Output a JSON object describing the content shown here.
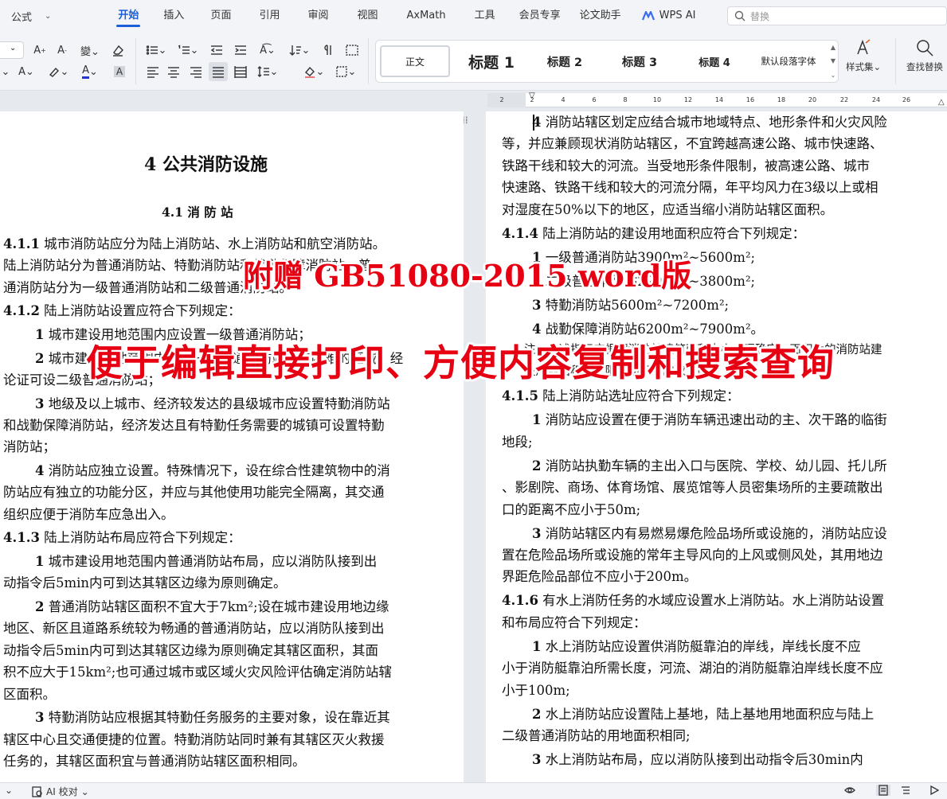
{
  "menubar": {
    "file_label": "公式",
    "tabs": [
      {
        "label": "开始",
        "active": true
      },
      {
        "label": "插入"
      },
      {
        "label": "页面"
      },
      {
        "label": "引用"
      },
      {
        "label": "审阅"
      },
      {
        "label": "视图"
      },
      {
        "label": "AxMath"
      },
      {
        "label": "工具"
      },
      {
        "label": "会员专享"
      },
      {
        "label": "论文助手"
      }
    ],
    "wps_ai": "WPS AI",
    "search_placeholder": "替换"
  },
  "toolbar": {
    "styles": [
      "正文",
      "标题 1",
      "标题 2",
      "标题 3",
      "标题 4",
      "默认段落字体"
    ],
    "style_set_label": "样式集",
    "find_replace_label": "查找替换"
  },
  "ruler_ticks": [
    "2",
    "2",
    "4",
    "6",
    "8",
    "10",
    "12",
    "14",
    "16",
    "18",
    "20",
    "22",
    "24",
    "26"
  ],
  "left_page": {
    "chapter_title": "4  公共消防设施",
    "section_title": "4.1 消 防 站",
    "lines": [
      {
        "num": "4.1.1",
        "text": "  城市消防站应分为陆上消防站、水上消防站和航空消防站。"
      },
      {
        "text": "陆上消防站分为普通消防站、特勤消防站和战勤保障消防站，普"
      },
      {
        "text": "通消防站分为一级普通消防站和二级普通消防站。"
      },
      {
        "num": "4.1.2",
        "text": "  陆上消防站设置应符合下列规定："
      },
      {
        "num": "1",
        "text": " 城市建设用地范围内应设置一级普通消防站；"
      },
      {
        "num": "2",
        "text": " 城市建设用地范围内设置一级普通消防站确有困难的区域，经"
      },
      {
        "text": "论证可设二级普通消防站；"
      },
      {
        "num": "3",
        "text": " 地级及以上城市、经济较发达的县级城市应设置特勤消防站"
      },
      {
        "text": "和战勤保障消防站，经济发达且有特勤任务需要的城镇可设置特勤"
      },
      {
        "text": "消防站；"
      },
      {
        "num": "4",
        "text": " 消防站应独立设置。特殊情况下，设在综合性建筑物中的消"
      },
      {
        "text": "防站应有独立的功能分区，并应与其他使用功能完全隔离，其交通"
      },
      {
        "text": "组织应便于消防车应急出入。"
      },
      {
        "num": "4.1.3",
        "text": "  陆上消防站布局应符合下列规定："
      },
      {
        "num": "1",
        "text": " 城市建设用地范围内普通消防站布局，应以消防队接到出"
      },
      {
        "text": "动指令后5min内可到达其辖区边缘为原则确定。"
      },
      {
        "num": "2",
        "text": " 普通消防站辖区面积不宜大于7km²;设在城市建设用地边缘"
      },
      {
        "text": "地区、新区且道路系统较为畅通的普通消防站，应以消防队接到出"
      },
      {
        "text": "动指令后5min内可到达其辖区边缘为原则确定其辖区面积，其面"
      },
      {
        "text": "积不应大于15km²;也可通过城市或区域火灾风险评估确定消防站辖"
      },
      {
        "text": "区面积。"
      },
      {
        "num": "3",
        "text": " 特勤消防站应根据其特勤任务服务的主要对象，设在靠近其"
      },
      {
        "text": "辖区中心且交通便捷的位置。特勤消防站同时兼有其辖区灭火救援"
      },
      {
        "text": "任务的，其辖区面积宜与普通消防站辖区面积相同。"
      }
    ]
  },
  "right_page": {
    "lines": [
      {
        "num": "4",
        "text": " 消防站辖区划定应结合城市地域特点、地形条件和火灾风险"
      },
      {
        "text": "等，并应兼顾现状消防站辖区，不宜跨越高速公路、城市快速路、"
      },
      {
        "text": "铁路干线和较大的河流。当受地形条件限制，被高速公路、城市"
      },
      {
        "text": "快速路、铁路干线和较大的河流分隔，年平均风力在3级以上或相"
      },
      {
        "text": "对湿度在50%以下的地区，应适当缩小消防站辖区面积。"
      },
      {
        "num": "4.1.4",
        "text": "  陆上消防站的建设用地面积应符合下列规定："
      },
      {
        "num": "1",
        "text": " 一级普通消防站3900m²~5600m²;"
      },
      {
        "num": "2",
        "text": " 二级普通消防站2200m²~3800m²;"
      },
      {
        "num": "3",
        "text": " 特勤消防站5600m²~7200m²;"
      },
      {
        "num": "4",
        "text": " 战勤保障消防站6200m²~7900m²。"
      },
      {
        "text": "注：上述指标应根据消防站建筑面积大小合理确定，面积大的消防站建"
      },
      {
        "text": "设用地面积取上限，面积小的取下限。"
      },
      {
        "num": "4.1.5",
        "text": "  陆上消防站选址应符合下列规定："
      },
      {
        "num": "1",
        "text": " 消防站应设置在便于消防车辆迅速出动的主、次干路的临街"
      },
      {
        "text": "地段;"
      },
      {
        "num": "2",
        "text": " 消防站执勤车辆的主出入口与医院、学校、幼儿园、托儿所"
      },
      {
        "text": "、影剧院、商场、体育场馆、展览馆等人员密集场所的主要疏散出"
      },
      {
        "text": "口的距离不应小于50m;"
      },
      {
        "num": "3",
        "text": " 消防站辖区内有易燃易爆危险品场所或设施的，消防站应设"
      },
      {
        "text": "置在危险品场所或设施的常年主导风向的上风或侧风处，其用地边"
      },
      {
        "text": "界距危险品部位不应小于200m。"
      },
      {
        "num": "4.1.6",
        "text": "  有水上消防任务的水域应设置水上消防站。水上消防站设置"
      },
      {
        "text": "和布局应符合下列规定："
      },
      {
        "num": "1",
        "text": " 水上消防站应设置供消防艇靠泊的岸线，岸线长度不应"
      },
      {
        "text": "小于消防艇靠泊所需长度，河流、湖泊的消防艇靠泊岸线长度不应"
      },
      {
        "text": "小于100m;"
      },
      {
        "num": "2",
        "text": " 水上消防站应设置陆上基地，陆上基地用地面积应与陆上"
      },
      {
        "text": "二级普通消防站的用地面积相同;"
      },
      {
        "num": "3",
        "text": " 水上消防站布局，应以消防队接到出动指令后30min内"
      }
    ]
  },
  "overlay": {
    "line1": "附赠 GB51080-2015 word版",
    "line2": "便于编辑直接打印、方便内容复制和搜索查询"
  },
  "statusbar": {
    "ai_check": "AI 校对"
  },
  "colors": {
    "accent": "#1a5fd6",
    "overlay_red": "#e60012"
  }
}
